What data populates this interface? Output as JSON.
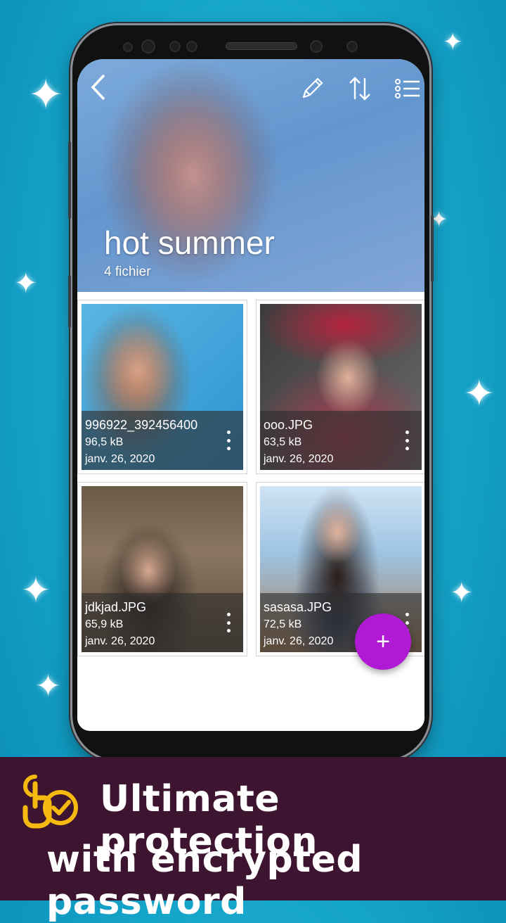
{
  "album": {
    "title": "hot summer",
    "count": "4 fichier"
  },
  "toolbar": {
    "back_icon": "chevron-left-icon",
    "edit_icon": "pencil-icon",
    "sort_icon": "sort-arrows-icon",
    "list_icon": "list-view-icon"
  },
  "files": [
    {
      "name": "996922_392456400",
      "size": "96,5 kB",
      "date": "janv. 26, 2020"
    },
    {
      "name": "ooo.JPG",
      "size": "63,5 kB",
      "date": "janv. 26, 2020"
    },
    {
      "name": "jdkjad.JPG",
      "size": "65,9 kB",
      "date": "janv. 26, 2020"
    },
    {
      "name": "sasasa.JPG",
      "size": "72,5 kB",
      "date": "janv. 26, 2020"
    }
  ],
  "fab": {
    "label": "+"
  },
  "banner": {
    "line1": "Ultimate protection",
    "line2": "with encrypted password"
  },
  "colors": {
    "background": "#14a3c9",
    "banner": "#3e1530",
    "fab": "#b01ad4",
    "logo": "#f5b90f"
  }
}
